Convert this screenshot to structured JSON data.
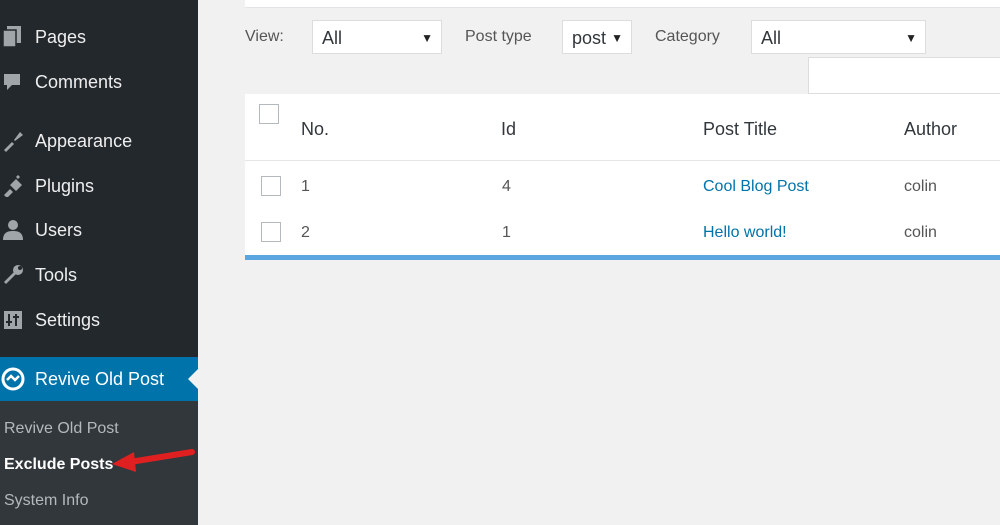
{
  "sidebar": {
    "items": [
      {
        "label": "Pages",
        "icon": "pages-icon"
      },
      {
        "label": "Comments",
        "icon": "comments-icon"
      },
      {
        "label": "Appearance",
        "icon": "appearance-icon"
      },
      {
        "label": "Plugins",
        "icon": "plugins-icon"
      },
      {
        "label": "Users",
        "icon": "users-icon"
      },
      {
        "label": "Tools",
        "icon": "tools-icon"
      },
      {
        "label": "Settings",
        "icon": "settings-icon"
      }
    ],
    "active": {
      "label": "Revive Old Post",
      "icon": "revive-icon"
    },
    "submenu": [
      "Revive Old Post",
      "Exclude Posts",
      "System Info"
    ]
  },
  "filters": {
    "view_label": "View:",
    "view_value": "All",
    "post_type_label": "Post type",
    "post_type_value": "post",
    "category_label": "Category",
    "category_value": "All"
  },
  "table": {
    "headers": [
      "No.",
      "Id",
      "Post Title",
      "Author"
    ],
    "rows": [
      {
        "no": "1",
        "id": "4",
        "title": "Cool Blog Post",
        "author": "colin"
      },
      {
        "no": "2",
        "id": "1",
        "title": "Hello world!",
        "author": "colin"
      }
    ]
  },
  "colors": {
    "sidebar_bg": "#23282d",
    "active_bg": "#0073aa",
    "link": "#0073aa",
    "table_bottom_border": "#5aa6e0",
    "annotation_arrow": "#e02020"
  }
}
